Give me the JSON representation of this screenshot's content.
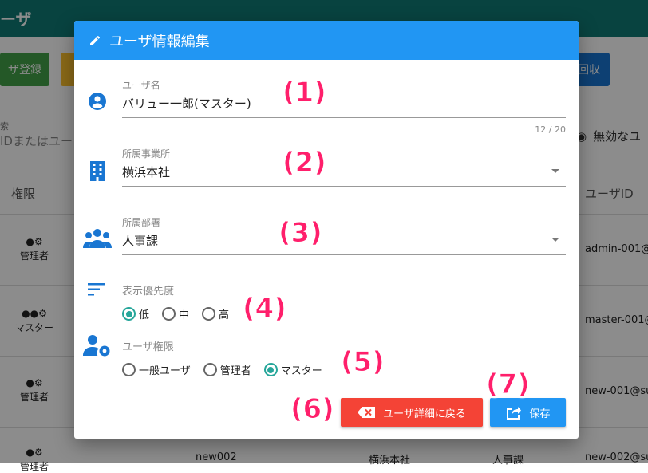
{
  "background": {
    "title": "ーザ",
    "buttons": [
      "ザ登録",
      "回収"
    ],
    "search_label": "索",
    "search_value": "IDまたはユー",
    "invalid_toggle": "無効なユ",
    "col_role": "権限",
    "col_userid": "ユーザID",
    "rows": [
      {
        "role": "管理者",
        "uid": "admin-001@"
      },
      {
        "role": "マスター",
        "uid": "master-001@"
      },
      {
        "role": "管理者",
        "uid": "new-001@su"
      },
      {
        "role": "管理者",
        "uid": "new-002@su"
      }
    ],
    "last_row_cells": [
      "new002",
      "横浜本社",
      "人事課"
    ]
  },
  "dialog": {
    "title": "ユーザ情報編集",
    "user_name": {
      "label": "ユーザ名",
      "value": "バリュー一郎(マスター)",
      "counter": "12 / 20"
    },
    "office": {
      "label": "所属事業所",
      "value": "横浜本社"
    },
    "department": {
      "label": "所属部署",
      "value": "人事課"
    },
    "priority": {
      "label": "表示優先度",
      "options": [
        "低",
        "中",
        "高"
      ],
      "selected": 0
    },
    "permission": {
      "label": "ユーザ権限",
      "options": [
        "一般ユーザ",
        "管理者",
        "マスター"
      ],
      "selected": 2
    },
    "back_button": "ユーザ詳細に戻る",
    "save_button": "保存"
  },
  "annotations": [
    "(1)",
    "(2)",
    "(3)",
    "(4)",
    "(5)",
    "(6)",
    "(7)"
  ],
  "colors": {
    "header": "#2196f3",
    "back_button": "#f44336",
    "save_button": "#2196f3",
    "radio": "#26a69a",
    "annotation": "#ff1f6b"
  }
}
